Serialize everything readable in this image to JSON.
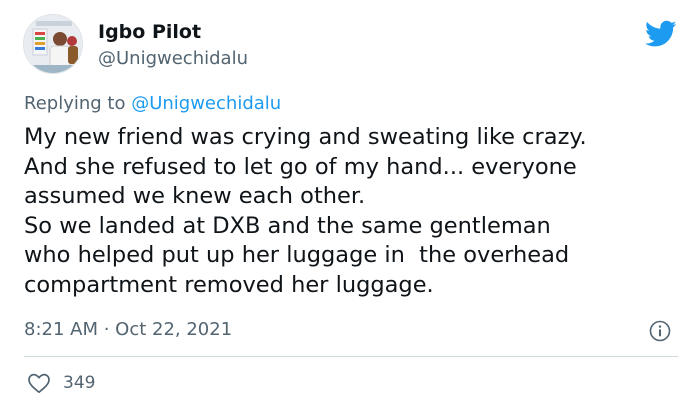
{
  "author": {
    "display_name": "Igbo Pilot",
    "handle": "@Unigwechidalu"
  },
  "reply_context": {
    "prefix": "Replying to ",
    "mention": "@Unigwechidalu"
  },
  "tweet": {
    "text": "My new friend was crying and sweating like crazy.\nAnd she refused to let go of my hand... everyone\nassumed we knew each other.\nSo we landed at DXB and the same gentleman\nwho helped put up her luggage in  the overhead\ncompartment removed her luggage.",
    "timestamp": "8:21 AM · Oct 22, 2021",
    "like_count": "349"
  },
  "icons": {
    "brand": "twitter-bird-icon",
    "info": "info-icon",
    "like": "heart-icon"
  },
  "colors": {
    "brand_blue": "#1d9bf0",
    "secondary_text": "#536471",
    "primary_text": "#0f1419",
    "divider": "#cfd9de"
  }
}
